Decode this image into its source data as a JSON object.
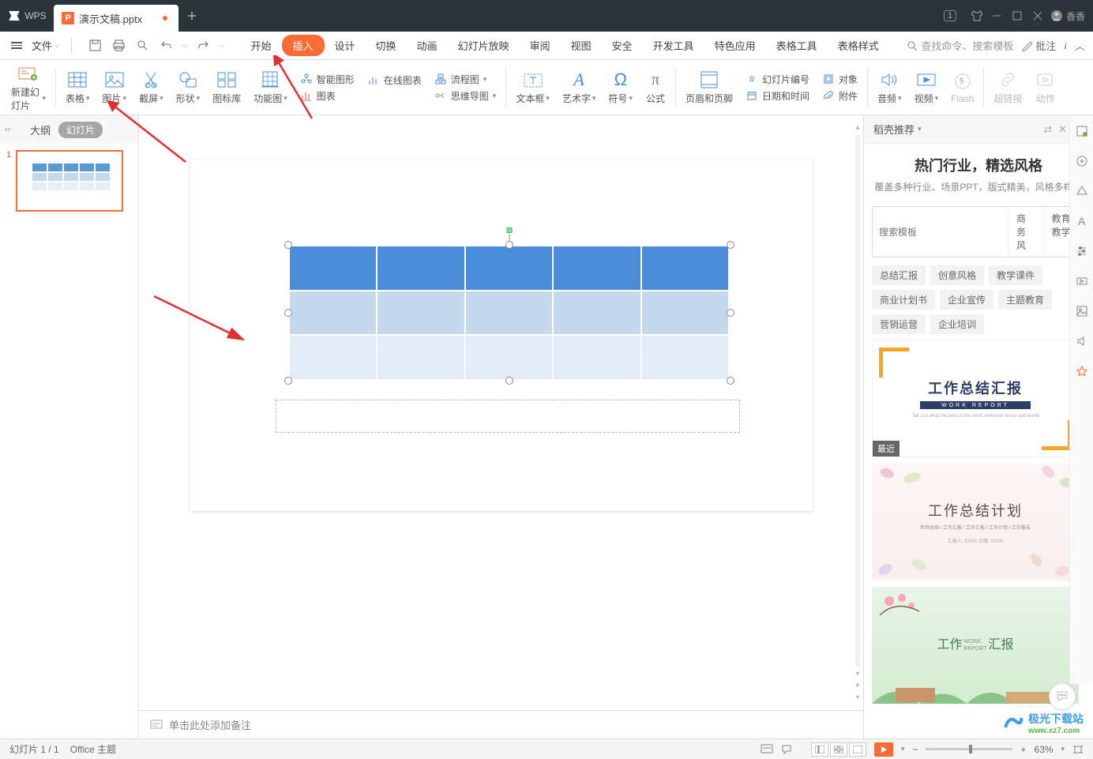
{
  "titlebar": {
    "app": "WPS",
    "tab_name": "演示文稿.pptx",
    "badge": "1",
    "user": "香香"
  },
  "menu": {
    "file": "文件",
    "tabs": [
      "开始",
      "插入",
      "设计",
      "切换",
      "动画",
      "幻灯片放映",
      "审阅",
      "视图",
      "安全",
      "开发工具",
      "特色应用",
      "表格工具",
      "表格样式"
    ],
    "active_index": 1,
    "search_placeholder": "查找命令、搜索模板",
    "comment": "批注"
  },
  "ribbon": {
    "new_slide": "新建幻灯片",
    "table": "表格",
    "picture": "图片",
    "screenshot": "截屏",
    "shapes": "形状",
    "icon_lib": "图标库",
    "func_chart": "功能图",
    "smart_graphic": "智能图形",
    "online_chart": "在线图表",
    "chart": "图表",
    "flowchart": "流程图",
    "mindmap": "思维导图",
    "textbox": "文本框",
    "wordart": "艺术字",
    "symbol": "符号",
    "equation": "公式",
    "header_footer": "页眉和页脚",
    "slide_number": "幻灯片编号",
    "date_time": "日期和时间",
    "object": "对象",
    "attachment": "附件",
    "audio": "音频",
    "video": "视频",
    "flash": "Flash",
    "hyperlink": "超链接",
    "action": "动作"
  },
  "left": {
    "outline": "大纲",
    "slides": "幻灯片",
    "slide_num": "1"
  },
  "notes_placeholder": "单击此处添加备注",
  "right": {
    "header": "稻壳推荐",
    "title": "热门行业，精选风格",
    "subtitle": "覆盖多种行业、场景PPT，版式精美，风格多样！",
    "search_placeholder": "搜索模板",
    "seg1": "商务风",
    "seg2": "教育教学",
    "tags": [
      "总结汇报",
      "创意风格",
      "教学课件",
      "商业计划书",
      "企业宣传",
      "主题教育",
      "营销运营",
      "企业培训"
    ],
    "tpl1_title": "工作总结汇报",
    "tpl1_bar": "WORK REPORT",
    "tpl1_badge": "最近",
    "tpl2_title": "工作总结计划",
    "tpl2_sub": "年终总结 / 工作汇报 / 工作汇报 / 工作计划 / 工作报告",
    "tpl2_foot": "汇报人: XXXX    日期: XXXX",
    "tpl3_a": "工作",
    "tpl3_b": "汇报",
    "tpl3_roman1": "WORK",
    "tpl3_roman2": "REPORT"
  },
  "status": {
    "slide_info": "幻灯片 1 / 1",
    "theme": "Office 主题",
    "zoom": "63%"
  },
  "watermark": {
    "name": "极光下载站",
    "url": "www.xz7.com"
  }
}
